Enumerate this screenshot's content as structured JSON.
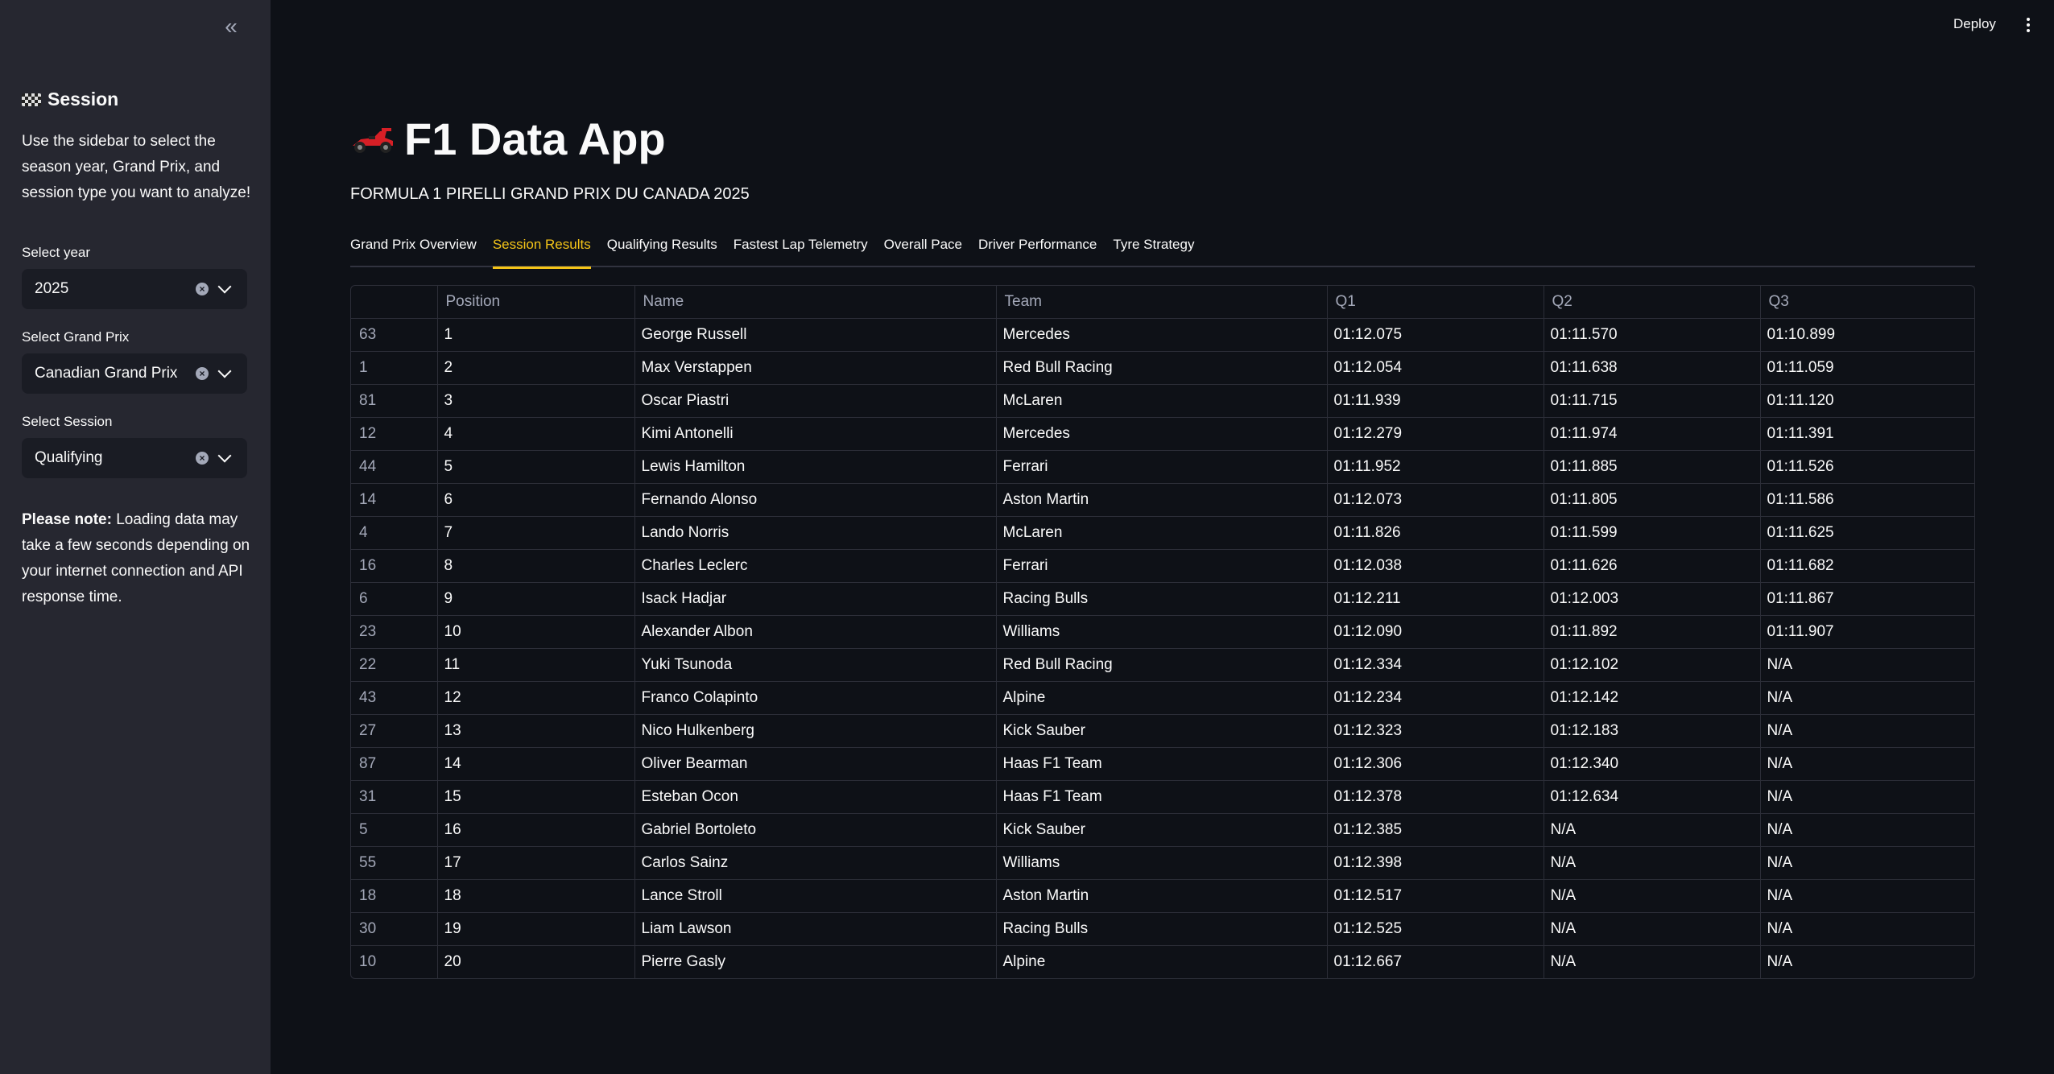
{
  "sidebar": {
    "collapse_icon": "«",
    "heading": "Session",
    "intro": "Use the sidebar to select the season year, Grand Prix, and session type you want to analyze!",
    "year_label": "Select year",
    "year_value": "2025",
    "gp_label": "Select Grand Prix",
    "gp_value": "Canadian Grand Prix",
    "session_label": "Select Session",
    "session_value": "Qualifying",
    "note_bold": "Please note:",
    "note_text": " Loading data may take a few seconds depending on your internet connection and API response time."
  },
  "header": {
    "deploy_label": "Deploy"
  },
  "main": {
    "title": "F1 Data App",
    "subtitle": "FORMULA 1 PIRELLI GRAND PRIX DU CANADA 2025",
    "tabs": [
      {
        "label": "Grand Prix Overview"
      },
      {
        "label": "Session Results"
      },
      {
        "label": "Qualifying Results"
      },
      {
        "label": "Fastest Lap Telemetry"
      },
      {
        "label": "Overall Pace"
      },
      {
        "label": "Driver Performance"
      },
      {
        "label": "Tyre Strategy"
      }
    ],
    "active_tab": 1,
    "table": {
      "headers": [
        "",
        "Position",
        "Name",
        "Team",
        "Q1",
        "Q2",
        "Q3"
      ],
      "rows": [
        [
          "63",
          "1",
          "George Russell",
          "Mercedes",
          "01:12.075",
          "01:11.570",
          "01:10.899"
        ],
        [
          "1",
          "2",
          "Max Verstappen",
          "Red Bull Racing",
          "01:12.054",
          "01:11.638",
          "01:11.059"
        ],
        [
          "81",
          "3",
          "Oscar Piastri",
          "McLaren",
          "01:11.939",
          "01:11.715",
          "01:11.120"
        ],
        [
          "12",
          "4",
          "Kimi Antonelli",
          "Mercedes",
          "01:12.279",
          "01:11.974",
          "01:11.391"
        ],
        [
          "44",
          "5",
          "Lewis Hamilton",
          "Ferrari",
          "01:11.952",
          "01:11.885",
          "01:11.526"
        ],
        [
          "14",
          "6",
          "Fernando Alonso",
          "Aston Martin",
          "01:12.073",
          "01:11.805",
          "01:11.586"
        ],
        [
          "4",
          "7",
          "Lando Norris",
          "McLaren",
          "01:11.826",
          "01:11.599",
          "01:11.625"
        ],
        [
          "16",
          "8",
          "Charles Leclerc",
          "Ferrari",
          "01:12.038",
          "01:11.626",
          "01:11.682"
        ],
        [
          "6",
          "9",
          "Isack Hadjar",
          "Racing Bulls",
          "01:12.211",
          "01:12.003",
          "01:11.867"
        ],
        [
          "23",
          "10",
          "Alexander Albon",
          "Williams",
          "01:12.090",
          "01:11.892",
          "01:11.907"
        ],
        [
          "22",
          "11",
          "Yuki Tsunoda",
          "Red Bull Racing",
          "01:12.334",
          "01:12.102",
          "N/A"
        ],
        [
          "43",
          "12",
          "Franco Colapinto",
          "Alpine",
          "01:12.234",
          "01:12.142",
          "N/A"
        ],
        [
          "27",
          "13",
          "Nico Hulkenberg",
          "Kick Sauber",
          "01:12.323",
          "01:12.183",
          "N/A"
        ],
        [
          "87",
          "14",
          "Oliver Bearman",
          "Haas F1 Team",
          "01:12.306",
          "01:12.340",
          "N/A"
        ],
        [
          "31",
          "15",
          "Esteban Ocon",
          "Haas F1 Team",
          "01:12.378",
          "01:12.634",
          "N/A"
        ],
        [
          "5",
          "16",
          "Gabriel Bortoleto",
          "Kick Sauber",
          "01:12.385",
          "N/A",
          "N/A"
        ],
        [
          "55",
          "17",
          "Carlos Sainz",
          "Williams",
          "01:12.398",
          "N/A",
          "N/A"
        ],
        [
          "18",
          "18",
          "Lance Stroll",
          "Aston Martin",
          "01:12.517",
          "N/A",
          "N/A"
        ],
        [
          "30",
          "19",
          "Liam Lawson",
          "Racing Bulls",
          "01:12.525",
          "N/A",
          "N/A"
        ],
        [
          "10",
          "20",
          "Pierre Gasly",
          "Alpine",
          "01:12.667",
          "N/A",
          "N/A"
        ]
      ]
    }
  },
  "colors": {
    "background": "#0e1117",
    "sidebar": "#262730",
    "accent": "#f5c518"
  }
}
